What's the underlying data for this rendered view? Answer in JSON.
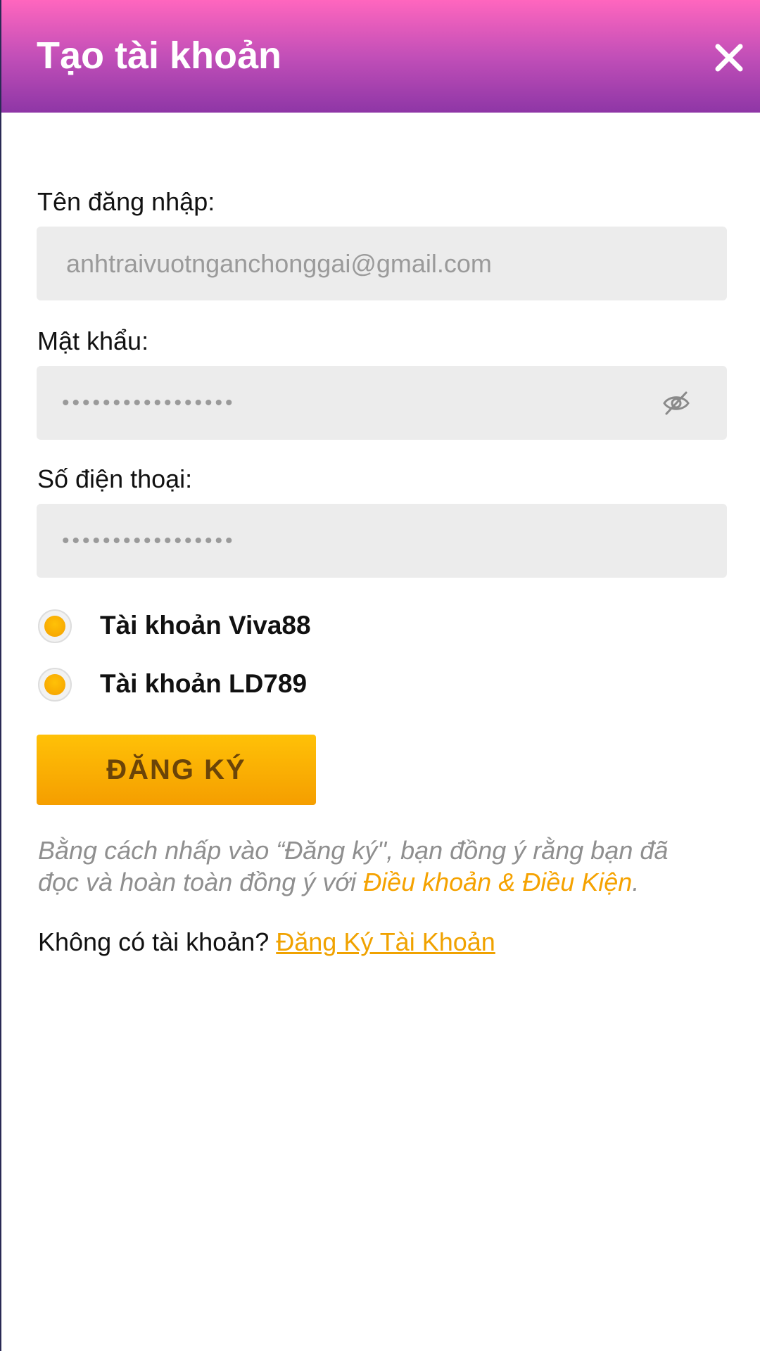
{
  "header": {
    "title": "Tạo tài khoản",
    "close_icon": "close-icon"
  },
  "form": {
    "username": {
      "label": "Tên đăng nhập:",
      "value": "anhtraivuotnganchonggai@gmail.com"
    },
    "password": {
      "label": "Mật khẩu:",
      "value": "•••••••••••••••••",
      "toggle_icon": "eye-slash-icon"
    },
    "phone": {
      "label": "Số điện thoại:",
      "value": "•••••••••••••••••"
    },
    "account_options": [
      {
        "label": "Tài khoản Viva88"
      },
      {
        "label": "Tài khoản LD789"
      }
    ],
    "submit_label": "ĐĂNG KÝ"
  },
  "terms": {
    "text": "Bằng cách nhấp vào “Đăng ký\", bạn đồng ý rằng bạn đã đọc và hoàn toàn đồng ý với ",
    "link": "Điều khoản & Điều Kiện",
    "suffix": "."
  },
  "footer": {
    "prompt": "Không có tài khoản? ",
    "link": "Đăng Ký Tài Khoản"
  },
  "colors": {
    "header_top": "#ff66be",
    "header_bottom": "#8e36a6",
    "accent": "#f5a200",
    "field_bg": "#ececec"
  }
}
